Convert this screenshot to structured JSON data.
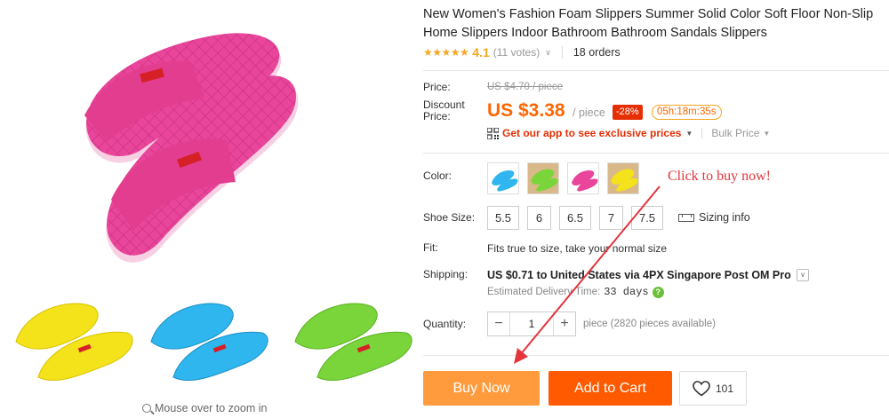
{
  "gallery": {
    "zoom_hint": "Mouse over to zoom in",
    "thumbnail_colors": [
      "#f4e21a",
      "#2fb6ee",
      "#7ad53a"
    ],
    "main_color": "#e9459a"
  },
  "product": {
    "title": "New Women's Fashion Foam Slippers Summer Solid Color Soft Floor Non-Slip Home Slippers Indoor Bathroom Bathroom Sandals Slippers",
    "stars": "★★★★★",
    "rating": "4.1",
    "votes": "(11 votes)",
    "orders": "18 orders"
  },
  "price": {
    "label": "Price:",
    "original": "US $4.70 / piece",
    "discount_label": "Discount Price:",
    "sale": "US $3.38",
    "unit": "/ piece",
    "off": "-28%",
    "timer": "05h:18m:35s",
    "app_promo": "Get our app to see exclusive prices",
    "bulk": "Bulk Price"
  },
  "options": {
    "color_label": "Color:",
    "colors": [
      "#2fb6ee",
      "#7ad53a",
      "#e9459a",
      "#f4e21a"
    ],
    "callout": "Click to buy now!",
    "size_label": "Shoe Size:",
    "sizes": [
      "5.5",
      "6",
      "6.5",
      "7",
      "7.5"
    ],
    "sizing_info": "Sizing info",
    "fit_label": "Fit:",
    "fit_text": "Fits true to size, take your normal size",
    "shipping_label": "Shipping:",
    "shipping_text": "US $0.71 to United States via 4PX Singapore Post OM Pro",
    "delivery_label": "Estimated Delivery Time:",
    "delivery_days": "33 days",
    "quantity_label": "Quantity:",
    "quantity_value": "1",
    "quantity_minus": "−",
    "quantity_plus": "+",
    "available": "piece (2820 pieces available)"
  },
  "actions": {
    "buy_now": "Buy Now",
    "add_to_cart": "Add to Cart",
    "wish_count": "101"
  },
  "colors": {
    "accent_orange": "#ff6600",
    "buy_now_bg": "#ff9b3d",
    "add_cart_bg": "#ff5a00",
    "discount_red": "#e62e04",
    "callout_red": "#e4343c"
  }
}
